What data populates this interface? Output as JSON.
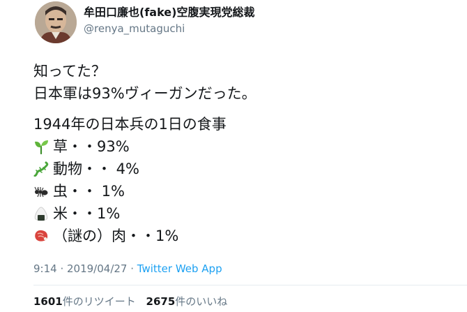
{
  "author": {
    "display_name": "牟田口廉也(fake)空腹実現党総裁",
    "handle": "@renya_mutaguchi"
  },
  "tweet": {
    "line1": "知ってた？",
    "line2": "日本軍は93%ヴィーガンだった。",
    "line3": "1944年の日本兵の1日の食事",
    "items": [
      {
        "icon": "seedling-icon",
        "text": "草・・93%"
      },
      {
        "icon": "lizard-icon",
        "text": "動物・・ 4%"
      },
      {
        "icon": "ant-icon",
        "text": "虫・・ 1%"
      },
      {
        "icon": "rice-ball-icon",
        "text": "米・・1%"
      },
      {
        "icon": "meat-icon",
        "text": "（謎の）肉・・1%"
      }
    ]
  },
  "meta": {
    "time": "9:14",
    "separator1": " · ",
    "date": "2019/04/27",
    "separator2": " · ",
    "source": "Twitter Web App"
  },
  "stats": {
    "retweets_count": "1601",
    "retweets_label": "件のリツイート",
    "likes_count": "2675",
    "likes_label": "件のいいね"
  },
  "colors": {
    "text": "#14171a",
    "secondary": "#657786",
    "link": "#1da1f2",
    "divider": "#e6ecf0"
  }
}
